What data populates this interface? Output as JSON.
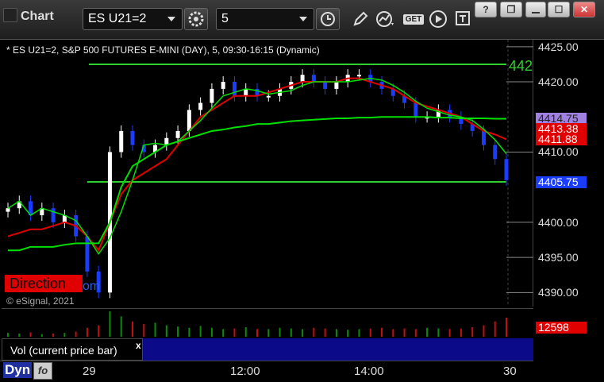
{
  "app": {
    "title": "Chart"
  },
  "toolbar": {
    "symbol": "ES U21=2",
    "interval": "5",
    "get_label": "GET"
  },
  "window_controls": {
    "help": "?",
    "restore": "❐",
    "maximize": "☐",
    "close": "✕"
  },
  "chart": {
    "header": "* ES U21=2, S&P 500 FUTURES E-MINI (DAY), 5, 09:30-16:15 (Dynamic)",
    "copyright": "© eSignal, 2021",
    "watermark_left": "Direction",
    "watermark_right": "om",
    "right_edge_label": "442",
    "y_ticks": [
      "4425.00",
      "4420.00",
      "4414.75",
      "4413.38",
      "4411.88",
      "4410.00",
      "4405.75",
      "4400.00",
      "4395.00",
      "4390.00"
    ],
    "x_ticks": [
      "29",
      "12:00",
      "14:00",
      "30"
    ],
    "last_price": "4405.75",
    "colors": {
      "up": "#ffffff",
      "down": "#1a3cff",
      "ma_fast": "#00e000",
      "ma_slow": "#e00000",
      "vwap": "#a080e0",
      "level": "#30d030"
    }
  },
  "volume": {
    "label": "Vol (current price bar)",
    "close_glyph": "x",
    "value": "12598"
  },
  "footer": {
    "dyn": "Dyn",
    "fx": "fo"
  },
  "chart_data": {
    "type": "line",
    "title": "* ES U21=2, S&P 500 FUTURES E-MINI (DAY), 5, 09:30-16:15 (Dynamic)",
    "xlabel": "",
    "ylabel": "",
    "ylim": [
      4388,
      4426
    ],
    "x_ticks": [
      "29",
      "12:00",
      "14:00",
      "30"
    ],
    "price_tags": [
      {
        "value": 4414.75,
        "label": "4414.75",
        "color": "#a080e0"
      },
      {
        "value": 4413.38,
        "label": "4413.38",
        "color": "#e00000"
      },
      {
        "value": 4411.88,
        "label": "4411.88",
        "color": "#e00000"
      },
      {
        "value": 4405.75,
        "label": "4405.75",
        "color": "#1a3cff"
      }
    ],
    "levels": [
      4422.5,
      4405.75
    ],
    "series": [
      {
        "values": [
          4402,
          4403,
          4401,
          4402,
          4400,
          4401,
          4398,
          4393,
          4390,
          4410,
          4413,
          4411,
          4410,
          4411,
          4412,
          4413,
          4416,
          4417,
          4419,
          4420,
          4418,
          4419,
          4418,
          4418,
          4419,
          4420,
          4421,
          4420,
          4419,
          4420,
          4421,
          4421,
          4420,
          4419,
          4418,
          4417,
          4415,
          4415,
          4416,
          4415,
          4414,
          4413,
          4411,
          4409,
          4406
        ]
      },
      {
        "values": [
          4398,
          4398.5,
          4399,
          4399,
          4399.5,
          4400,
          4399.5,
          4398,
          4396,
          4400,
          4404,
          4406,
          4407,
          4408,
          4409,
          4411,
          4413,
          4415,
          4416,
          4417,
          4418,
          4418,
          4418,
          4418.5,
          4419,
          4419.5,
          4420,
          4420,
          4420,
          4420,
          4420.5,
          4420.5,
          4420,
          4419.5,
          4419,
          4418,
          4417,
          4416.5,
          4416,
          4415.5,
          4415,
          4414,
          4413,
          4412.5,
          4411.8
        ]
      },
      {
        "values": [
          4396,
          4396,
          4396.5,
          4396.5,
          4396.5,
          4396.8,
          4397,
          4397,
          4397,
          4400,
          4405,
          4408,
          4409,
          4410,
          4411,
          4411.5,
          4412,
          4412.5,
          4413,
          4413.2,
          4413.5,
          4413.7,
          4414,
          4414,
          4414.2,
          4414.4,
          4414.5,
          4414.6,
          4414.7,
          4414.8,
          4414.8,
          4414.9,
          4414.9,
          4415,
          4415,
          4415,
          4415,
          4415,
          4414.9,
          4414.9,
          4414.8,
          4414.8,
          4414.8,
          4414.75,
          4414.75
        ]
      }
    ],
    "volume": [
      6,
      5,
      7,
      4,
      5,
      6,
      8,
      14,
      18,
      40,
      32,
      24,
      20,
      22,
      18,
      16,
      14,
      17,
      14,
      12,
      13,
      15,
      12,
      12,
      14,
      13,
      12,
      14,
      13,
      12,
      11,
      12,
      13,
      14,
      12,
      13,
      12,
      14,
      13,
      12,
      13,
      15,
      18,
      24,
      30
    ]
  }
}
